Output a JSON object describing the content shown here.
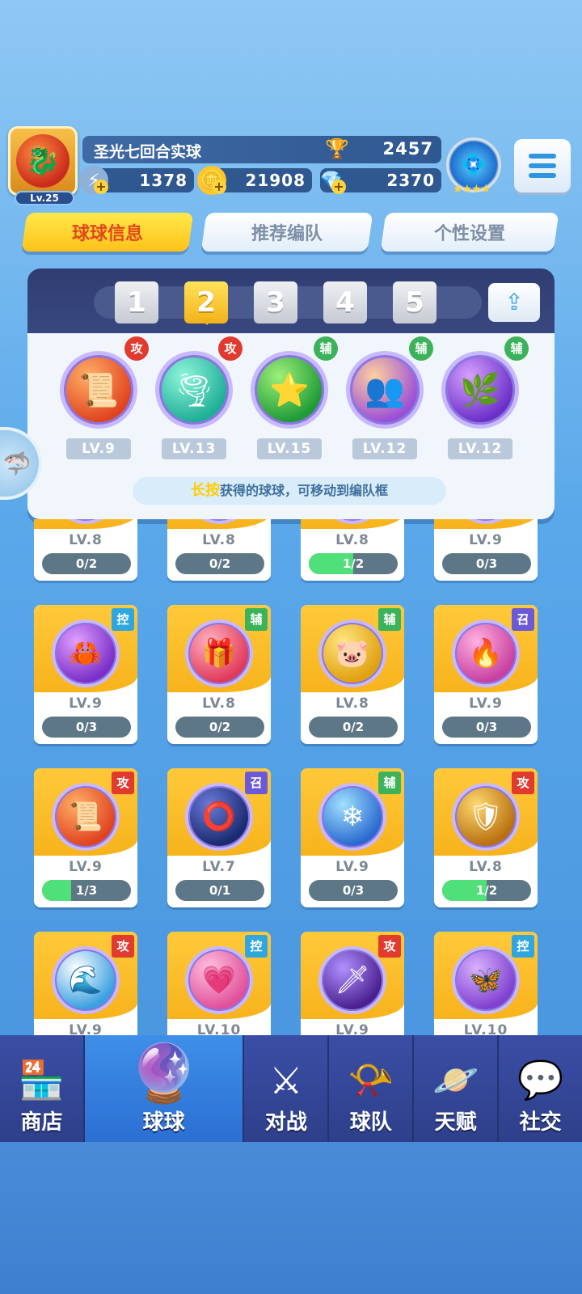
{
  "player": {
    "level": "Lv.25",
    "name": "圣光七回合实球",
    "trophies": "2457",
    "currency": [
      {
        "icon": "energy-icon",
        "value": "1378"
      },
      {
        "icon": "gold-coin-icon",
        "value": "21908"
      },
      {
        "icon": "diamond-icon",
        "value": "2370"
      }
    ]
  },
  "tabs": [
    {
      "label": "球球信息",
      "active": true
    },
    {
      "label": "推荐编队",
      "active": false
    },
    {
      "label": "个性设置",
      "active": false
    }
  ],
  "team": {
    "slots": [
      "1",
      "2",
      "3",
      "4",
      "5"
    ],
    "active_slot": "2",
    "balls": [
      {
        "name": "scroll-ball-icon",
        "type": "攻",
        "level": "LV.9"
      },
      {
        "name": "whirlwind-ball-icon",
        "type": "攻",
        "level": "LV.13"
      },
      {
        "name": "star-arrow-ball-icon",
        "type": "辅",
        "level": "LV.15"
      },
      {
        "name": "crowd-ball-icon",
        "type": "辅",
        "level": "LV.12"
      },
      {
        "name": "leaf-ball-icon",
        "type": "辅",
        "level": "LV.12"
      }
    ],
    "hint_highlight": "长按",
    "hint_text": "获得的球球，可移动到编队框"
  },
  "cards": [
    {
      "name": "hidden-ball-1",
      "type": "",
      "level": "LV.8",
      "progress": "0/2",
      "fill": 0
    },
    {
      "name": "hidden-ball-2",
      "type": "",
      "level": "LV.8",
      "progress": "0/2",
      "fill": 0
    },
    {
      "name": "hidden-ball-3",
      "type": "",
      "level": "LV.8",
      "progress": "1/2",
      "fill": 0.5
    },
    {
      "name": "hidden-ball-4",
      "type": "",
      "level": "LV.9",
      "progress": "0/3",
      "fill": 0
    },
    {
      "name": "claw-ball-icon",
      "type": "控",
      "level": "LV.9",
      "progress": "0/3",
      "fill": 0
    },
    {
      "name": "gift-ball-icon",
      "type": "辅",
      "level": "LV.8",
      "progress": "0/2",
      "fill": 0
    },
    {
      "name": "piggy-bank-ball-icon",
      "type": "辅",
      "level": "LV.8",
      "progress": "0/2",
      "fill": 0
    },
    {
      "name": "phoenix-ball-icon",
      "type": "召",
      "level": "LV.9",
      "progress": "0/3",
      "fill": 0
    },
    {
      "name": "scroll-ball-icon",
      "type": "攻",
      "level": "LV.9",
      "progress": "1/3",
      "fill": 0.33
    },
    {
      "name": "dark-ring-ball-icon",
      "type": "召",
      "level": "LV.7",
      "progress": "0/1",
      "fill": 0
    },
    {
      "name": "ice-crystal-ball-icon",
      "type": "辅",
      "level": "LV.9",
      "progress": "0/3",
      "fill": 0
    },
    {
      "name": "warrior-ball-icon",
      "type": "攻",
      "level": "LV.8",
      "progress": "1/2",
      "fill": 0.5
    },
    {
      "name": "wave-ball-icon",
      "type": "攻",
      "level": "LV.9",
      "progress": "",
      "fill": 0
    },
    {
      "name": "heart-ball-icon",
      "type": "控",
      "level": "LV.10",
      "progress": "",
      "fill": 0
    },
    {
      "name": "sword-ball-icon",
      "type": "攻",
      "level": "LV.9",
      "progress": "",
      "fill": 0
    },
    {
      "name": "butterfly-ball-icon",
      "type": "控",
      "level": "LV.10",
      "progress": "",
      "fill": 0
    }
  ],
  "nav": [
    {
      "label": "商店",
      "icon": "shop-icon",
      "selected": false
    },
    {
      "label": "球球",
      "icon": "balls-icon",
      "selected": true
    },
    {
      "label": "对战",
      "icon": "crossed-swords-icon",
      "selected": false
    },
    {
      "label": "球队",
      "icon": "whistle-icon",
      "selected": false
    },
    {
      "label": "天赋",
      "icon": "planet-icon",
      "selected": false
    },
    {
      "label": "社交",
      "icon": "chat-heart-icon",
      "selected": false
    }
  ],
  "colors": {
    "attack": "#e13a2f",
    "support": "#3cb35a",
    "control": "#2fa6e0",
    "summon": "#6a5ad8",
    "card_top": "#ffc93a",
    "progress_fill": "#4fe07a"
  }
}
